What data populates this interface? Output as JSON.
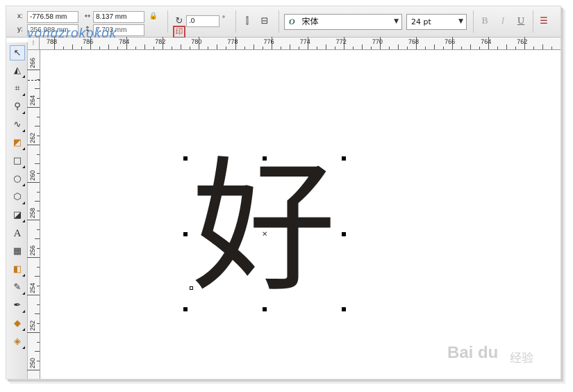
{
  "propbar": {
    "x_label": "x:",
    "x_value": "-776.58 mm",
    "y_label": "y:",
    "y_value": "256.988 mm",
    "width_value": "8.137 mm",
    "height_value": "7.703 mm",
    "rotation_value": ".0",
    "degree_symbol": "°",
    "font_name": "宋体",
    "font_size": "24 pt",
    "bold_label": "B",
    "italic_label": "I",
    "underline_label": "U",
    "font_italic_glyph": "O"
  },
  "watermark": {
    "text": "vongzrokokok",
    "seal": "印"
  },
  "ruler": {
    "horizontal": [
      "788",
      "786",
      "784",
      "782",
      "780",
      "778",
      "776",
      "774",
      "772",
      "770",
      "768",
      "766",
      "764",
      "762"
    ],
    "vertical": [
      "266",
      "264",
      "262",
      "260",
      "258",
      "256",
      "254",
      "252",
      "250"
    ]
  },
  "canvas": {
    "glyph": "好"
  },
  "tools": [
    "pick",
    "shape",
    "crop",
    "zoom",
    "freehand",
    "smart-fill",
    "rectangle",
    "ellipse",
    "polygon",
    "basic-shapes",
    "text",
    "table",
    "blend",
    "eyedropper",
    "outline",
    "fill",
    "interactive-fill"
  ],
  "baidu": {
    "brand": "Bai du",
    "sub": "经验"
  }
}
